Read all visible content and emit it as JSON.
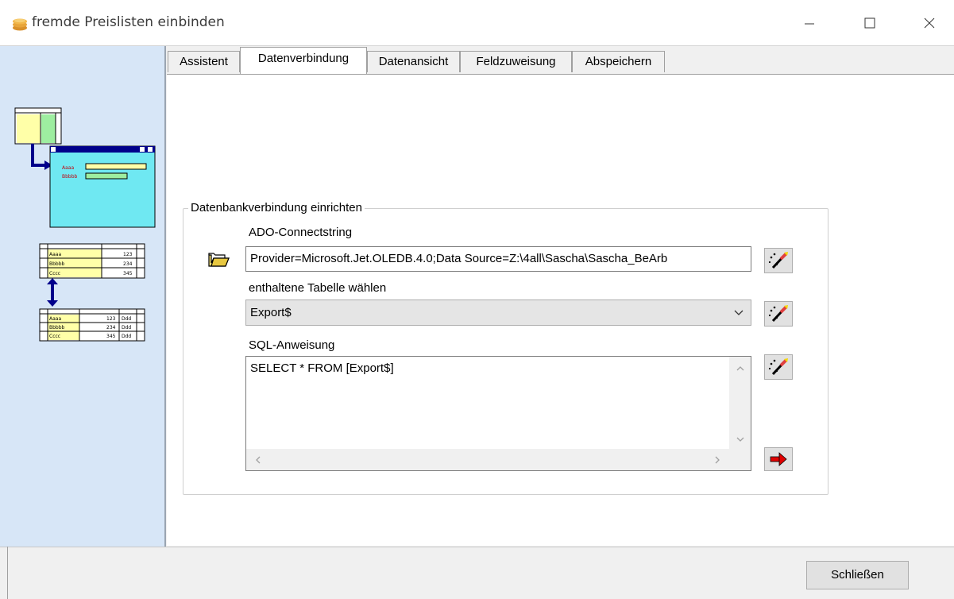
{
  "window": {
    "title": "fremde Preislisten einbinden"
  },
  "tabs": [
    {
      "label": "Assistent",
      "active": false
    },
    {
      "label": "Datenverbindung",
      "active": true
    },
    {
      "label": "Datenansicht",
      "active": false
    },
    {
      "label": "Feldzuweisung",
      "active": false
    },
    {
      "label": "Abspeichern",
      "active": false
    }
  ],
  "group": {
    "title": "Datenbankverbindung einrichten",
    "connection": {
      "label": "ADO-Connectstring",
      "value": "Provider=Microsoft.Jet.OLEDB.4.0;Data Source=Z:\\4all\\Sascha\\Sascha_BeArb"
    },
    "table": {
      "label": "enthaltene Tabelle wählen",
      "selected": "Export$"
    },
    "sql": {
      "label": "SQL-Anweisung",
      "value": "SELECT * FROM [Export$]"
    }
  },
  "footer": {
    "close_label": "Schließen"
  },
  "colors": {
    "panel_bg": "#d7e6f7",
    "accent_blue": "#00008b",
    "cyan": "#6fe8f2",
    "yellow": "#ffffa8",
    "green": "#9eeea0"
  },
  "illustration": {
    "rows": [
      "Aaaa",
      "Bbbbb",
      "Cccc"
    ],
    "values": [
      "123",
      "234",
      "345"
    ],
    "units": [
      "Ddd",
      "Ddd",
      "Ddd"
    ]
  }
}
